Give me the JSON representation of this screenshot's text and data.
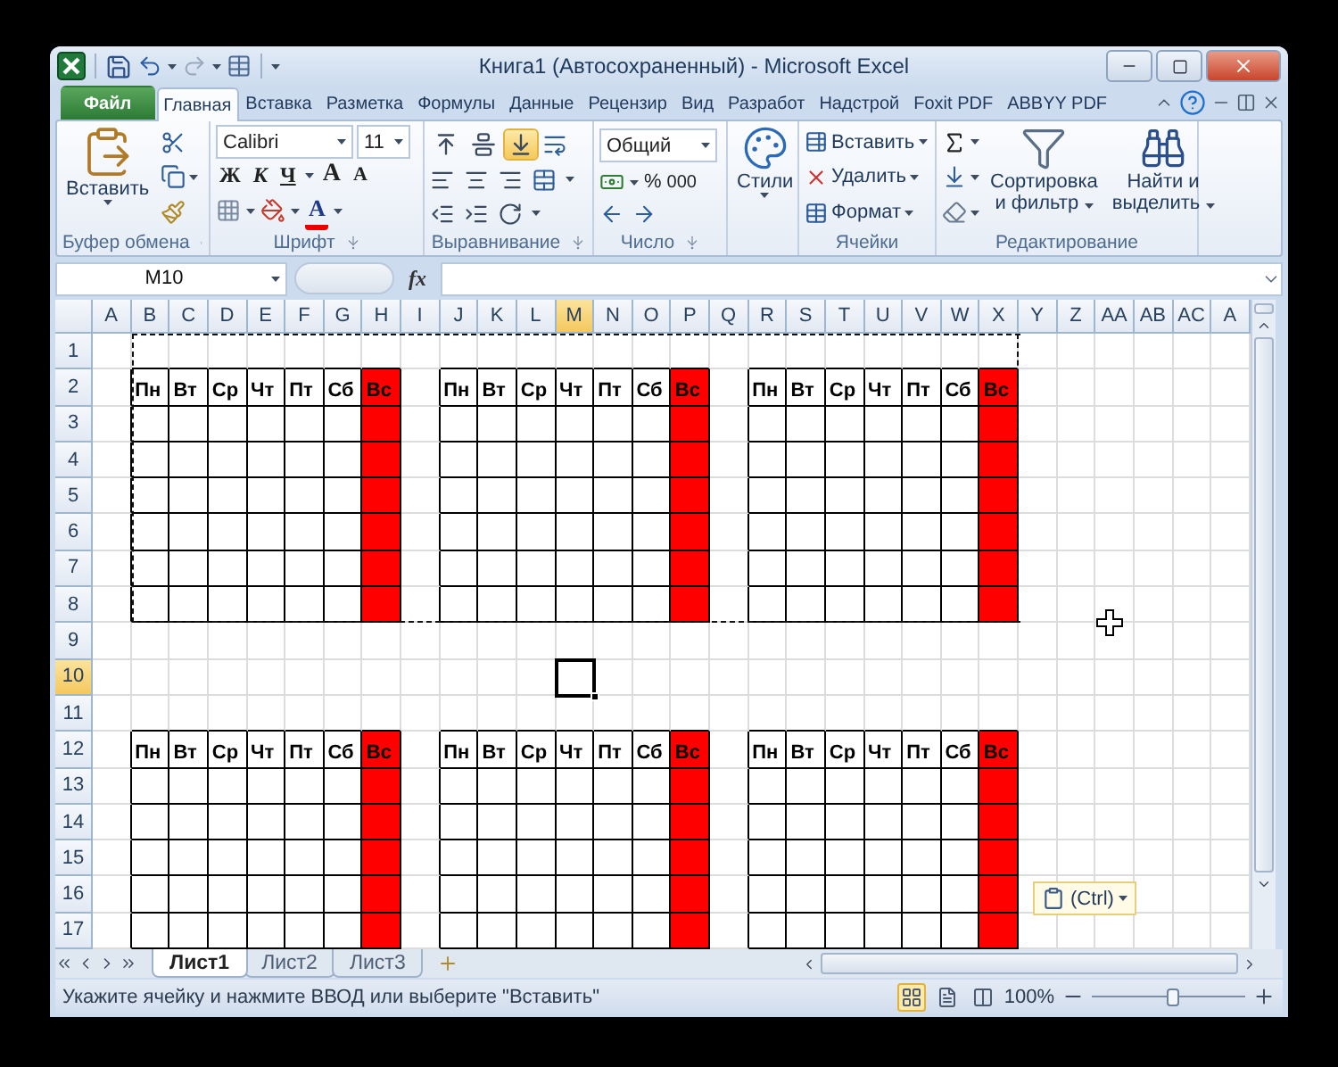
{
  "window": {
    "title": "Книга1 (Автосохраненный)  -  Microsoft Excel"
  },
  "ribbon_tabs": [
    {
      "label": "Файл",
      "kind": "file",
      "selected": false
    },
    {
      "label": "Главная",
      "kind": "tab",
      "selected": true
    },
    {
      "label": "Вставка",
      "kind": "tab",
      "selected": false
    },
    {
      "label": "Разметка",
      "kind": "tab",
      "selected": false
    },
    {
      "label": "Формулы",
      "kind": "tab",
      "selected": false
    },
    {
      "label": "Данные",
      "kind": "tab",
      "selected": false
    },
    {
      "label": "Рецензир",
      "kind": "tab",
      "selected": false
    },
    {
      "label": "Вид",
      "kind": "tab",
      "selected": false
    },
    {
      "label": "Разработ",
      "kind": "tab",
      "selected": false
    },
    {
      "label": "Надстрой",
      "kind": "tab",
      "selected": false
    },
    {
      "label": "Foxit PDF",
      "kind": "tab",
      "selected": false
    },
    {
      "label": "ABBYY PDF",
      "kind": "tab",
      "selected": false
    }
  ],
  "clipboard": {
    "paste": "Вставить",
    "group": "Буфер обмена"
  },
  "font": {
    "name": "Calibri",
    "size": "11",
    "bold": "Ж",
    "italic": "К",
    "underline": "Ч",
    "grow": "A",
    "shrink": "A",
    "font_color": "A",
    "group": "Шрифт"
  },
  "alignment": {
    "vertical": [
      {
        "selected": false
      },
      {
        "selected": false
      },
      {
        "selected": true
      }
    ],
    "group": "Выравнивание"
  },
  "number": {
    "format": "Общий",
    "percent": "%",
    "thousands": "000",
    "group": "Число"
  },
  "styles": {
    "label": "Стили"
  },
  "cells": {
    "items": [
      "Вставить",
      "Удалить",
      "Формат"
    ],
    "group": "Ячейки"
  },
  "editing": {
    "sort": [
      "Сортировка",
      "и фильтр"
    ],
    "find": [
      "Найти и",
      "выделить"
    ],
    "group": "Редактирование"
  },
  "formula_bar": {
    "name_box": "M10",
    "fx": "fx"
  },
  "sheet": {
    "copied": true,
    "columns": [
      {
        "label": "A",
        "selected": false
      },
      {
        "label": "B",
        "selected": false
      },
      {
        "label": "C",
        "selected": false
      },
      {
        "label": "D",
        "selected": false
      },
      {
        "label": "E",
        "selected": false
      },
      {
        "label": "F",
        "selected": false
      },
      {
        "label": "G",
        "selected": false
      },
      {
        "label": "H",
        "selected": false
      },
      {
        "label": "I",
        "selected": false
      },
      {
        "label": "J",
        "selected": false
      },
      {
        "label": "K",
        "selected": false
      },
      {
        "label": "L",
        "selected": false
      },
      {
        "label": "M",
        "selected": true
      },
      {
        "label": "N",
        "selected": false
      },
      {
        "label": "O",
        "selected": false
      },
      {
        "label": "P",
        "selected": false
      },
      {
        "label": "Q",
        "selected": false
      },
      {
        "label": "R",
        "selected": false
      },
      {
        "label": "S",
        "selected": false
      },
      {
        "label": "T",
        "selected": false
      },
      {
        "label": "U",
        "selected": false
      },
      {
        "label": "V",
        "selected": false
      },
      {
        "label": "W",
        "selected": false
      },
      {
        "label": "X",
        "selected": false
      },
      {
        "label": "Y",
        "selected": false
      },
      {
        "label": "Z",
        "selected": false
      },
      {
        "label": "AA",
        "selected": false
      },
      {
        "label": "AB",
        "selected": false
      },
      {
        "label": "AC",
        "selected": false
      },
      {
        "label": "A",
        "selected": false
      }
    ],
    "rows": [
      {
        "label": "1",
        "selected": false
      },
      {
        "label": "2",
        "selected": false
      },
      {
        "label": "3",
        "selected": false
      },
      {
        "label": "4",
        "selected": false
      },
      {
        "label": "5",
        "selected": false
      },
      {
        "label": "6",
        "selected": false
      },
      {
        "label": "7",
        "selected": false
      },
      {
        "label": "8",
        "selected": false
      },
      {
        "label": "9",
        "selected": false
      },
      {
        "label": "10",
        "selected": true
      },
      {
        "label": "11",
        "selected": false
      },
      {
        "label": "12",
        "selected": false
      },
      {
        "label": "13",
        "selected": false
      },
      {
        "label": "14",
        "selected": false
      },
      {
        "label": "15",
        "selected": false
      },
      {
        "label": "16",
        "selected": false
      },
      {
        "label": "17",
        "selected": false
      }
    ],
    "calendars": [
      {
        "days": [
          {
            "label": "Пн",
            "highlighted": false
          },
          {
            "label": "Вт",
            "highlighted": false
          },
          {
            "label": "Ср",
            "highlighted": false
          },
          {
            "label": "Чт",
            "highlighted": false
          },
          {
            "label": "Пт",
            "highlighted": false
          },
          {
            "label": "Сб",
            "highlighted": false
          },
          {
            "label": "Вс",
            "highlighted": true
          }
        ]
      },
      {
        "days": [
          {
            "label": "Пн",
            "highlighted": false
          },
          {
            "label": "Вт",
            "highlighted": false
          },
          {
            "label": "Ср",
            "highlighted": false
          },
          {
            "label": "Чт",
            "highlighted": false
          },
          {
            "label": "Пт",
            "highlighted": false
          },
          {
            "label": "Сб",
            "highlighted": false
          },
          {
            "label": "Вс",
            "highlighted": true
          }
        ]
      },
      {
        "days": [
          {
            "label": "Пн",
            "highlighted": false
          },
          {
            "label": "Вт",
            "highlighted": false
          },
          {
            "label": "Ср",
            "highlighted": false
          },
          {
            "label": "Чт",
            "highlighted": false
          },
          {
            "label": "Пт",
            "highlighted": false
          },
          {
            "label": "Сб",
            "highlighted": false
          },
          {
            "label": "Вс",
            "highlighted": true
          }
        ]
      },
      {
        "days": [
          {
            "label": "Пн",
            "highlighted": false
          },
          {
            "label": "Вт",
            "highlighted": false
          },
          {
            "label": "Ср",
            "highlighted": false
          },
          {
            "label": "Чт",
            "highlighted": false
          },
          {
            "label": "Пт",
            "highlighted": false
          },
          {
            "label": "Сб",
            "highlighted": false
          },
          {
            "label": "Вс",
            "highlighted": true
          }
        ]
      },
      {
        "days": [
          {
            "label": "Пн",
            "highlighted": false
          },
          {
            "label": "Вт",
            "highlighted": false
          },
          {
            "label": "Ср",
            "highlighted": false
          },
          {
            "label": "Чт",
            "highlighted": false
          },
          {
            "label": "Пт",
            "highlighted": false
          },
          {
            "label": "Сб",
            "highlighted": false
          },
          {
            "label": "Вс",
            "highlighted": true
          }
        ]
      },
      {
        "days": [
          {
            "label": "Пн",
            "highlighted": false
          },
          {
            "label": "Вт",
            "highlighted": false
          },
          {
            "label": "Ср",
            "highlighted": false
          },
          {
            "label": "Чт",
            "highlighted": false
          },
          {
            "label": "Пт",
            "highlighted": false
          },
          {
            "label": "Сб",
            "highlighted": false
          },
          {
            "label": "Вс",
            "highlighted": true
          }
        ]
      }
    ]
  },
  "paste_options": {
    "label": "(Ctrl)"
  },
  "sheet_tabs": [
    {
      "label": "Лист1",
      "selected": true
    },
    {
      "label": "Лист2",
      "selected": false
    },
    {
      "label": "Лист3",
      "selected": false
    }
  ],
  "status_bar": {
    "message": "Укажите ячейку и нажмите ВВОД или выберите \"Вставить\"",
    "views": [
      {
        "selected": true
      },
      {
        "selected": false
      },
      {
        "selected": false
      }
    ],
    "zoom": {
      "reading": "100%",
      "level": 0.52
    }
  }
}
